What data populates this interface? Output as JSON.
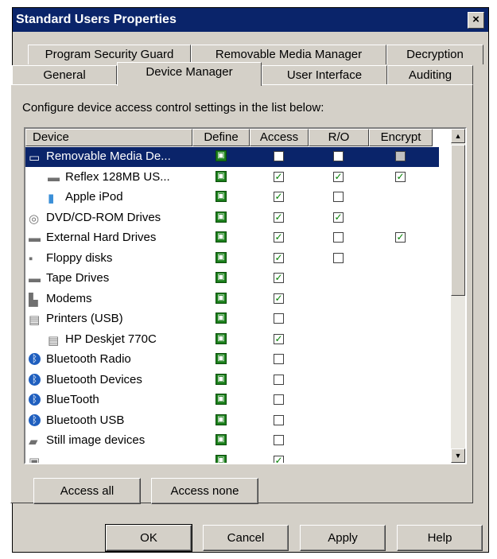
{
  "window": {
    "title": "Standard Users Properties",
    "close_label": "×"
  },
  "tabs": {
    "row1": [
      {
        "label": "Program Security Guard"
      },
      {
        "label": "Removable Media Manager"
      },
      {
        "label": "Decryption"
      }
    ],
    "row2": [
      {
        "label": "General"
      },
      {
        "label": "Device Manager",
        "selected": true
      },
      {
        "label": "User Interface"
      },
      {
        "label": "Auditing"
      }
    ]
  },
  "description": "Configure device access control settings in the list below:",
  "columns": [
    "Device",
    "Define",
    "Access",
    "R/O",
    "Encrypt"
  ],
  "devices": [
    {
      "name": "Removable Media De...",
      "icon": "removable-media-icon",
      "level": 0,
      "define": true,
      "access": "unchecked",
      "ro": "unchecked",
      "encrypt": "grey",
      "selected": true
    },
    {
      "name": "Reflex 128MB US...",
      "icon": "usb-drive-icon",
      "level": 1,
      "define": true,
      "access": "checked",
      "ro": "checked",
      "encrypt": "checked"
    },
    {
      "name": "Apple iPod",
      "icon": "ipod-icon",
      "level": 1,
      "define": true,
      "access": "checked",
      "ro": "unchecked",
      "encrypt": "none"
    },
    {
      "name": "DVD/CD-ROM Drives",
      "icon": "cd-drive-icon",
      "level": 0,
      "define": true,
      "access": "checked",
      "ro": "checked",
      "encrypt": "none"
    },
    {
      "name": "External Hard Drives",
      "icon": "hard-drive-icon",
      "level": 0,
      "define": true,
      "access": "checked",
      "ro": "unchecked",
      "encrypt": "checked"
    },
    {
      "name": "Floppy disks",
      "icon": "floppy-icon",
      "level": 0,
      "define": true,
      "access": "checked",
      "ro": "unchecked",
      "encrypt": "none"
    },
    {
      "name": "Tape Drives",
      "icon": "tape-drive-icon",
      "level": 0,
      "define": true,
      "access": "checked",
      "ro": "none",
      "encrypt": "none"
    },
    {
      "name": "Modems",
      "icon": "modem-icon",
      "level": 0,
      "define": true,
      "access": "checked",
      "ro": "none",
      "encrypt": "none"
    },
    {
      "name": "Printers (USB)",
      "icon": "printer-icon",
      "level": 0,
      "define": true,
      "access": "unchecked",
      "ro": "none",
      "encrypt": "none"
    },
    {
      "name": "HP Deskjet 770C",
      "icon": "printer-icon",
      "level": 1,
      "define": true,
      "access": "checked",
      "ro": "none",
      "encrypt": "none"
    },
    {
      "name": "Bluetooth Radio",
      "icon": "bluetooth-icon",
      "level": 0,
      "define": true,
      "access": "unchecked",
      "ro": "none",
      "encrypt": "none"
    },
    {
      "name": "Bluetooth Devices",
      "icon": "bluetooth-icon",
      "level": 0,
      "define": true,
      "access": "unchecked",
      "ro": "none",
      "encrypt": "none"
    },
    {
      "name": "BlueTooth",
      "icon": "bluetooth-icon",
      "level": 0,
      "define": true,
      "access": "unchecked",
      "ro": "none",
      "encrypt": "none"
    },
    {
      "name": "Bluetooth USB",
      "icon": "bluetooth-icon",
      "level": 0,
      "define": true,
      "access": "unchecked",
      "ro": "none",
      "encrypt": "none"
    },
    {
      "name": "Still image devices",
      "icon": "scanner-icon",
      "level": 0,
      "define": true,
      "access": "unchecked",
      "ro": "none",
      "encrypt": "none"
    },
    {
      "name": "",
      "icon": "infrared-icon",
      "level": 0,
      "define": true,
      "access": "checked",
      "ro": "none",
      "encrypt": "none"
    }
  ],
  "buttons": {
    "access_all": "Access all",
    "access_none": "Access none",
    "ok": "OK",
    "cancel": "Cancel",
    "apply": "Apply",
    "help": "Help"
  },
  "colors": {
    "selection": "#0a246a",
    "check_green": "#008000",
    "define_lock_green": "#1a7f1a"
  }
}
